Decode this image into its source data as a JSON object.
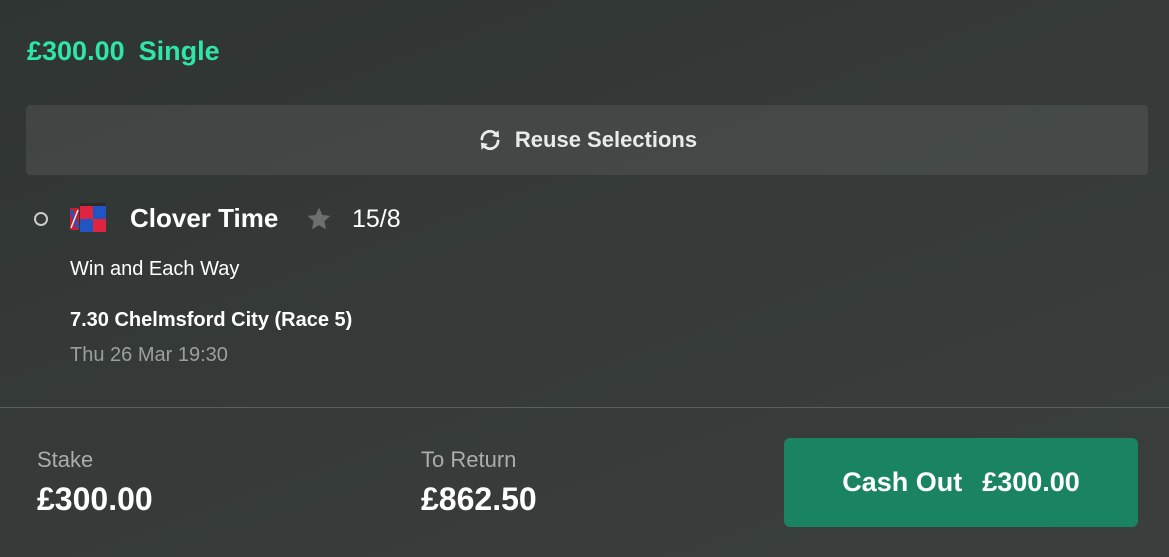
{
  "bet": {
    "amount": "£300.00",
    "type": "Single"
  },
  "reuse": {
    "label": "Reuse Selections",
    "icon": "refresh-icon"
  },
  "selection": {
    "runner": "Clover Time",
    "odds": "15/8",
    "market": "Win and Each Way",
    "race": "7.30 Chelmsford City (Race 5)",
    "datetime": "Thu 26 Mar 19:30",
    "icons": [
      "radio-icon",
      "jockey-silks-icon",
      "star-icon"
    ]
  },
  "footer": {
    "stake_label": "Stake",
    "stake_value": "£300.00",
    "return_label": "To Return",
    "return_value": "£862.50",
    "cashout_label": "Cash Out",
    "cashout_amount": "£300.00"
  },
  "colors": {
    "accent_green": "#2ee6a6",
    "cashout_green": "#1a8462",
    "background": "#343937"
  }
}
